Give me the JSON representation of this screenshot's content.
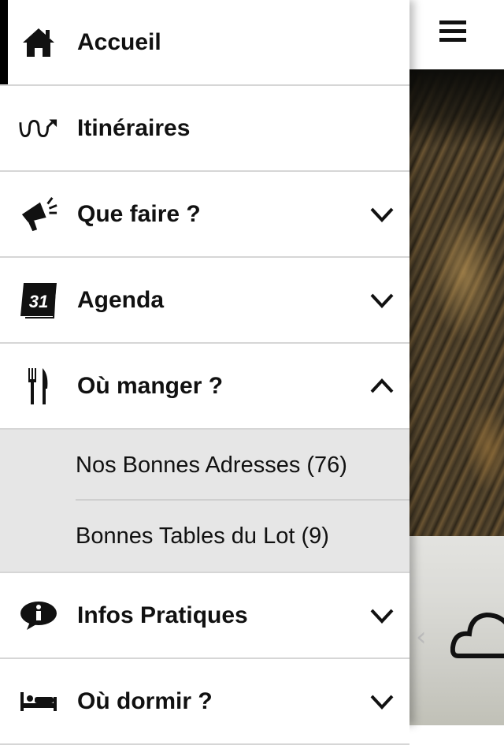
{
  "menu": {
    "items": [
      {
        "label": "Accueil",
        "icon": "home-icon",
        "active": true
      },
      {
        "label": "Itinéraires",
        "icon": "route-icon"
      },
      {
        "label": "Que faire ?",
        "icon": "megaphone-icon",
        "expandable": true
      },
      {
        "label": "Agenda",
        "icon": "calendar-icon",
        "expandable": true,
        "icon_text": "31"
      },
      {
        "label": "Où manger ?",
        "icon": "fork-knife-icon",
        "expandable": true,
        "expanded": true,
        "subitems": [
          {
            "label": "Nos Bonnes Adresses (76)"
          },
          {
            "label": "Bonnes Tables du Lot (9)"
          }
        ]
      },
      {
        "label": "Infos Pratiques",
        "icon": "info-icon",
        "expandable": true
      },
      {
        "label": "Où dormir ?",
        "icon": "bed-icon",
        "expandable": true
      }
    ]
  },
  "colors": {
    "active_indicator": "#000000",
    "submenu_bg": "#e6e6e6",
    "divider": "#d6d6d6"
  }
}
